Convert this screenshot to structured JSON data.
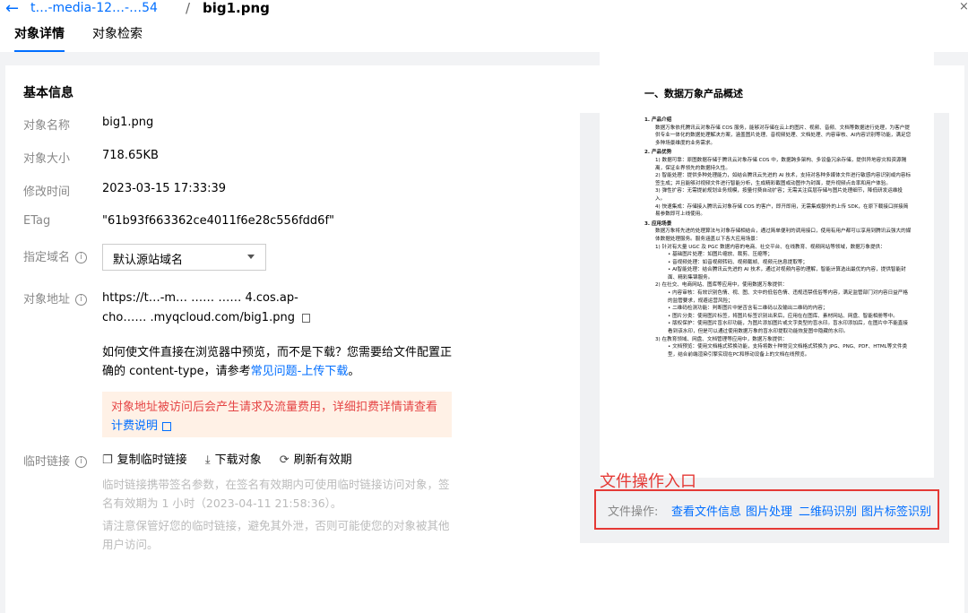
{
  "header": {
    "back_icon": "arrow-left-icon",
    "bucket": "t…-media-12…-…54",
    "separator": "/",
    "file_name": "big1.png",
    "close_icon": "close-icon"
  },
  "tabs": [
    {
      "label": "对象详情",
      "active": true
    },
    {
      "label": "对象检索",
      "active": false
    }
  ],
  "basic": {
    "title": "基本信息",
    "rows": {
      "name_label": "对象名称",
      "name_value": "big1.png",
      "size_label": "对象大小",
      "size_value": "718.65KB",
      "mtime_label": "修改时间",
      "mtime_value": "2023-03-15 17:33:39",
      "etag_label": "ETag",
      "etag_value": "\"61b93f663362ce4011f6e28c556fdd6f\"",
      "domain_label": "指定域名",
      "domain_value": "默认源站域名",
      "addr_label": "对象地址",
      "addr_value_1": "https://t…-m… …… …… 4.cos.ap-",
      "addr_value_2": "cho…… .myqcloud.com/big1.png"
    },
    "tip_text": "如何使文件直接在浏览器中预览，而不是下载？您需要给文件配置正确的 content-type，请参考",
    "tip_link": "常见问题-上传下载",
    "tip_end": "。",
    "warn_text": "对象地址被访问后会产生请求及流量费用，详细扣费详情请查看",
    "warn_link": "计费说明",
    "temp_label": "临时链接",
    "actions": {
      "copy": "复制临时链接",
      "download": "下载对象",
      "refresh": "刷新有效期"
    },
    "temp_note_1": "临时链接携带签名参数，在签名有效期内可使用临时链接访问对象，签名有效期为 1 小时（2023-04-11 21:58:36）。",
    "temp_note_2": "请注意保管好您的临时链接，避免其外泄，否则可能使您的对象被其他用户访问。"
  },
  "preview": {
    "title": "一、数据万象产品概述",
    "lines": [
      {
        "t": "1. 产品介绍",
        "c": "h"
      },
      {
        "t": "数据万象依托腾讯云对象存储 COS 服务，能够对存储在云上的图片、视频、音频、文档等数据进行处理，为客户提供专业一体化的数据处理解决方案，涵盖图片处理、音视频处理、文档处理、内容审核、AI内容识别等功能，满足您多种场景维度的业务需求。",
        "c": "ind"
      },
      {
        "t": "2. 产品优势",
        "c": "h"
      },
      {
        "t": "1) 数据可靠：原图数据存储于腾讯云对象存储 COS 中，数据跨多架构、多设备冗余存储，提供异地容灾和资源隔离，保证业界领先的数据持久性。",
        "c": "ind"
      },
      {
        "t": "2) 智能处理：提供多种处理能力，如结合腾讯云先进的 AI 技术，支持对各种多媒体文件进行敏感内容识别或内容标签生成；并且能够对视频文件进行智能分析，生成精彩截图或动图作为封面，提升视频点击率和用户体验。",
        "c": "ind"
      },
      {
        "t": "3) 弹性扩容：无需提前规划业务规模，按量付费自动扩容；无需关注底层存储与图片处理细节，降低研发运维投入。",
        "c": "ind"
      },
      {
        "t": "4) 快速集成：存储接入腾讯云对象存储 COS 的客户，即开即用，无需集成额外的上传 SDK，在原下载接口拼接简易参数即可上线使用。",
        "c": "ind"
      },
      {
        "t": "3. 应用场景",
        "c": "h"
      },
      {
        "t": "数据万象将先进的处理算法与对象存储相结合，通过简单便利的调用接口，使用有用户都可以享用到腾讯云强大的媒体数据处理服务。服务涵盖以下各大应用场景：",
        "c": "ind"
      },
      {
        "t": "1) 针对有大量 UGC 及 PGC 数据内容的电商、社交平台、在线教育、视频网站等领域，数据万象提供：",
        "c": "ind"
      },
      {
        "t": "• 基础图片处理：如图片缩放、裁剪、压缩等；",
        "c": "ind2"
      },
      {
        "t": "• 音视频处理：如音视频转码、视频截帧、视频元信息提取等；",
        "c": "ind2"
      },
      {
        "t": "• AI智能处理：结合腾讯云先进的 AI 技术，通过对视频内容的理解，智能计算选出最优的内容，提供智能封面、精彩集锦服务。",
        "c": "ind2"
      },
      {
        "t": "2) 在社交、电商网站、图库等应用中，使用数据万象提供：",
        "c": "ind"
      },
      {
        "t": "• 内容审核：有效识别色情、视、图、文中的低俗色情、违规违禁低俗等内容，满足监管部门对内容日益严格的监管要求，规避运营风险；",
        "c": "ind2"
      },
      {
        "t": "• 二维码检测功能：判断图片中是否含有二维码以及输出二维码的内容；",
        "c": "ind2"
      },
      {
        "t": "• 图片分类：使用图片标签，将图片标签识别出来后，应用在在图库、素材网站、网盘、智能相册等中。",
        "c": "ind2"
      },
      {
        "t": "• 版权保护：使用图片盲水印功能，为图片添加图片或文字类型的盲水印。盲水印添加后，在图片中不能直接看到该水印，但是可以通过使用数据万象的盲水印提取功能恢复图中隐藏的水印。",
        "c": "ind2"
      },
      {
        "t": "3) 在教育领域、网盘、文档管理等应用中，数据万象提供：",
        "c": "ind"
      },
      {
        "t": "• 文档预览：使用文档格式转换功能，支持将数十种常见文档格式转换为 JPG、PNG、PDF、HTML等文件类型，结合前端渲染引擎实现在PC和移动设备上的文档在线预览。",
        "c": "ind2"
      }
    ]
  },
  "annotation": "文件操作入口",
  "file_ops": {
    "label": "文件操作:",
    "items": [
      "查看文件信息",
      "图片处理",
      "二维码识别",
      "图片标签识别"
    ]
  }
}
